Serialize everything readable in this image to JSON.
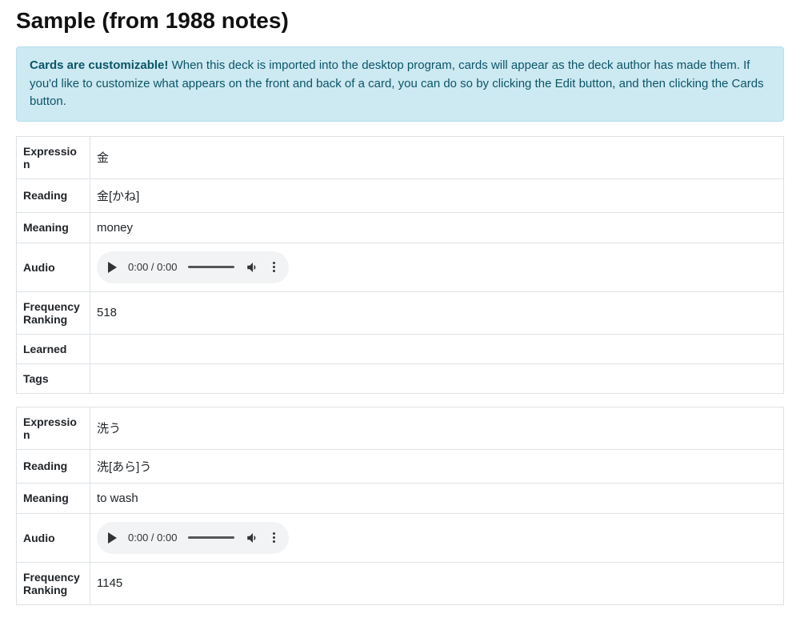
{
  "title": "Sample (from 1988 notes)",
  "alert": {
    "bold": "Cards are customizable!",
    "text": "When this deck is imported into the desktop program, cards will appear as the deck author has made them. If you'd like to customize what appears on the front and back of a card, you can do so by clicking the Edit button, and then clicking the Cards button."
  },
  "labels": {
    "expression": "Expression",
    "reading": "Reading",
    "meaning": "Meaning",
    "audio": "Audio",
    "frequency": "Frequency Ranking",
    "learned": "Learned",
    "tags": "Tags"
  },
  "audio_time": "0:00 / 0:00",
  "notes": [
    {
      "expression": "金",
      "reading": "金[かね]",
      "meaning": "money",
      "frequency": "518",
      "learned": "",
      "tags": ""
    },
    {
      "expression": "洗う",
      "reading": "洗[あら]う",
      "meaning": "to wash",
      "frequency": "1145",
      "learned": "",
      "tags": ""
    }
  ]
}
